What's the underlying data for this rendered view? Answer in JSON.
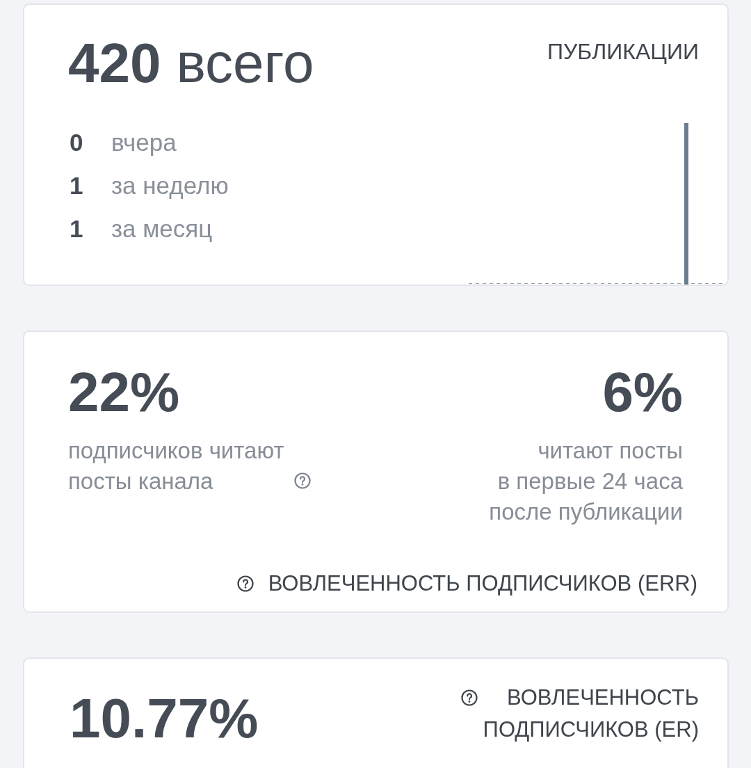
{
  "publications": {
    "total": "420",
    "total_label": "всего",
    "title": "ПУБЛИКАЦИИ",
    "periods": [
      {
        "value": "0",
        "label": "вчера"
      },
      {
        "value": "1",
        "label": "за неделю"
      },
      {
        "value": "1",
        "label": "за месяц"
      }
    ]
  },
  "reach": {
    "metrics": [
      {
        "value": "22%",
        "description": "подписчиков читают\nпосты канала",
        "help": true
      },
      {
        "value": "6%",
        "description": "читают посты\nв первые 24 часа\nпосле публикации",
        "help": false
      }
    ],
    "footer": {
      "label": "ВОВЛЕЧЕННОСТЬ ПОДПИСЧИКОВ (ERR)",
      "help": true
    }
  },
  "engagement": {
    "value": "10.77%",
    "label": "ВОВЛЕЧЕННОСТЬ\nПОДПИСЧИКОВ (ER)",
    "help": true
  }
}
